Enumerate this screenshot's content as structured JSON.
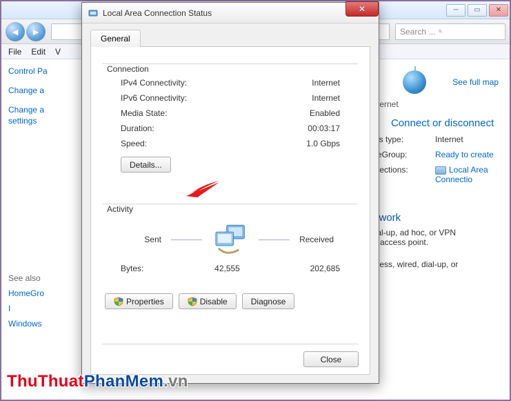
{
  "explorer": {
    "menus": [
      "File",
      "Edit",
      "V"
    ],
    "search_placeholder": "Search ..."
  },
  "sidebar": {
    "links": [
      "Control Pa",
      "Change a",
      "Change a",
      "settings"
    ],
    "see_also_label": "See also",
    "see_also": [
      "HomeGro",
      "I",
      "Windows"
    ]
  },
  "right": {
    "see_full_map": "See full map",
    "internet_label": "Internet",
    "connect_heading": "Connect or disconnect",
    "rows": [
      {
        "label": "ess type:",
        "value": "Internet",
        "link": false
      },
      {
        "label": "meGroup:",
        "value": "Ready to create",
        "link": true
      },
      {
        "label": "nnections:",
        "value": "Local Area Connectio",
        "link": true,
        "icon": true
      }
    ],
    "network_heading": "etwork",
    "network_text1": "dial-up, ad hoc, or VPN",
    "network_text2": "or access point.",
    "network_text3": "reless, wired, dial-up, or"
  },
  "dialog": {
    "title": "Local Area Connection Status",
    "tab": "General",
    "connection_legend": "Connection",
    "connection": [
      {
        "label": "IPv4 Connectivity:",
        "value": "Internet"
      },
      {
        "label": "IPv6 Connectivity:",
        "value": "Internet"
      },
      {
        "label": "Media State:",
        "value": "Enabled"
      },
      {
        "label": "Duration:",
        "value": "00:03:17"
      },
      {
        "label": "Speed:",
        "value": "1.0 Gbps"
      }
    ],
    "details_btn": "Details...",
    "activity_legend": "Activity",
    "sent_label": "Sent",
    "received_label": "Received",
    "bytes_label": "Bytes:",
    "bytes_sent": "42,555",
    "bytes_received": "202,685",
    "properties_btn": "Properties",
    "disable_btn": "Disable",
    "diagnose_btn": "Diagnose",
    "close_btn": "Close"
  },
  "watermark": {
    "p1": "ThuThuat",
    "p2": "PhanMem",
    "p3": ".vn"
  }
}
